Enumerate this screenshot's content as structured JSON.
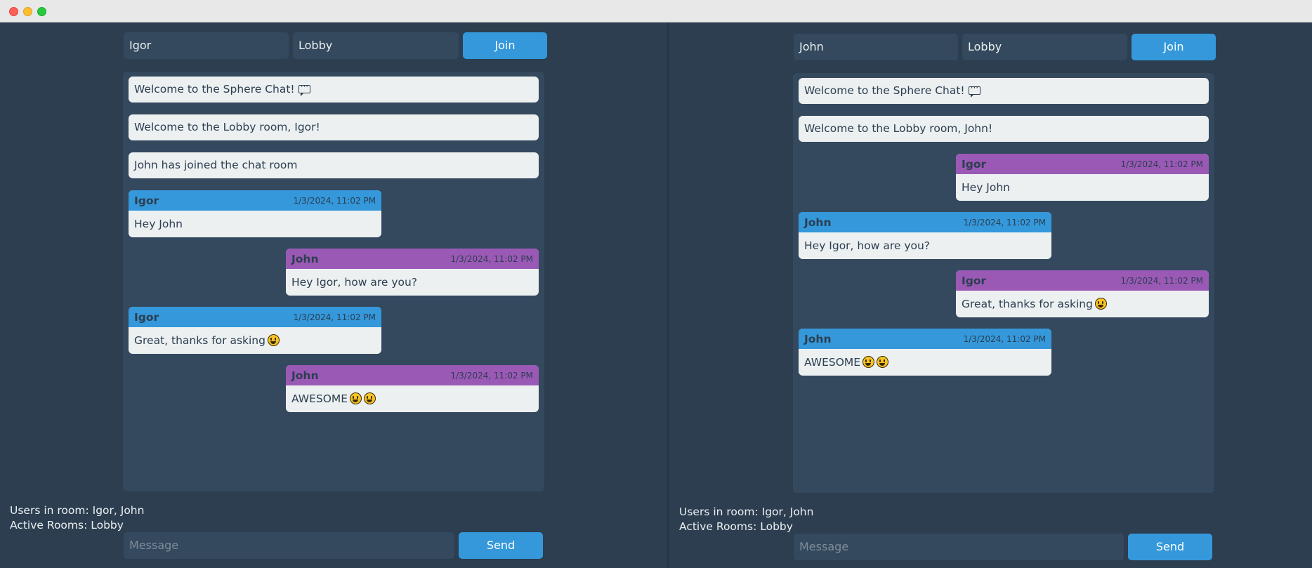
{
  "left_panel": {
    "username": "Igor",
    "room": "Lobby",
    "join_label": "Join",
    "system_messages": [
      "Welcome to the Sphere Chat!",
      "Welcome to the Lobby room, Igor!",
      "John has joined the chat room"
    ],
    "messages": [
      {
        "user": "Igor",
        "time": "1/3/2024, 11:02 PM",
        "text": "Hey John"
      },
      {
        "user": "John",
        "time": "1/3/2024, 11:02 PM",
        "text": "Hey Igor, how are you?"
      },
      {
        "user": "Igor",
        "time": "1/3/2024, 11:02 PM",
        "text": "Great, thanks for asking"
      },
      {
        "user": "John",
        "time": "1/3/2024, 11:02 PM",
        "text": "AWESOME"
      }
    ],
    "users_in_room": "Users in room: Igor, John",
    "active_rooms": "Active Rooms: Lobby",
    "message_placeholder": "Message",
    "send_label": "Send"
  },
  "right_panel": {
    "username": "John",
    "room": "Lobby",
    "join_label": "Join",
    "system_messages": [
      "Welcome to the Sphere Chat!",
      "Welcome to the Lobby room, John!"
    ],
    "messages": [
      {
        "user": "Igor",
        "time": "1/3/2024, 11:02 PM",
        "text": "Hey John"
      },
      {
        "user": "John",
        "time": "1/3/2024, 11:02 PM",
        "text": "Hey Igor, how are you?"
      },
      {
        "user": "Igor",
        "time": "1/3/2024, 11:02 PM",
        "text": "Great, thanks for asking"
      },
      {
        "user": "John",
        "time": "1/3/2024, 11:02 PM",
        "text": "AWESOME"
      }
    ],
    "users_in_room": "Users in room: Igor, John",
    "active_rooms": "Active Rooms: Lobby",
    "message_placeholder": "Message",
    "send_label": "Send"
  },
  "colors": {
    "background": "#2c3e50",
    "panel": "#34495e",
    "accent_blue": "#3498db",
    "accent_purple": "#9b59b6",
    "bubble": "#ecf0f1"
  },
  "icons": {
    "welcome_icon": "speech-bubble-icon",
    "emoji": "grinning-face-icon"
  }
}
